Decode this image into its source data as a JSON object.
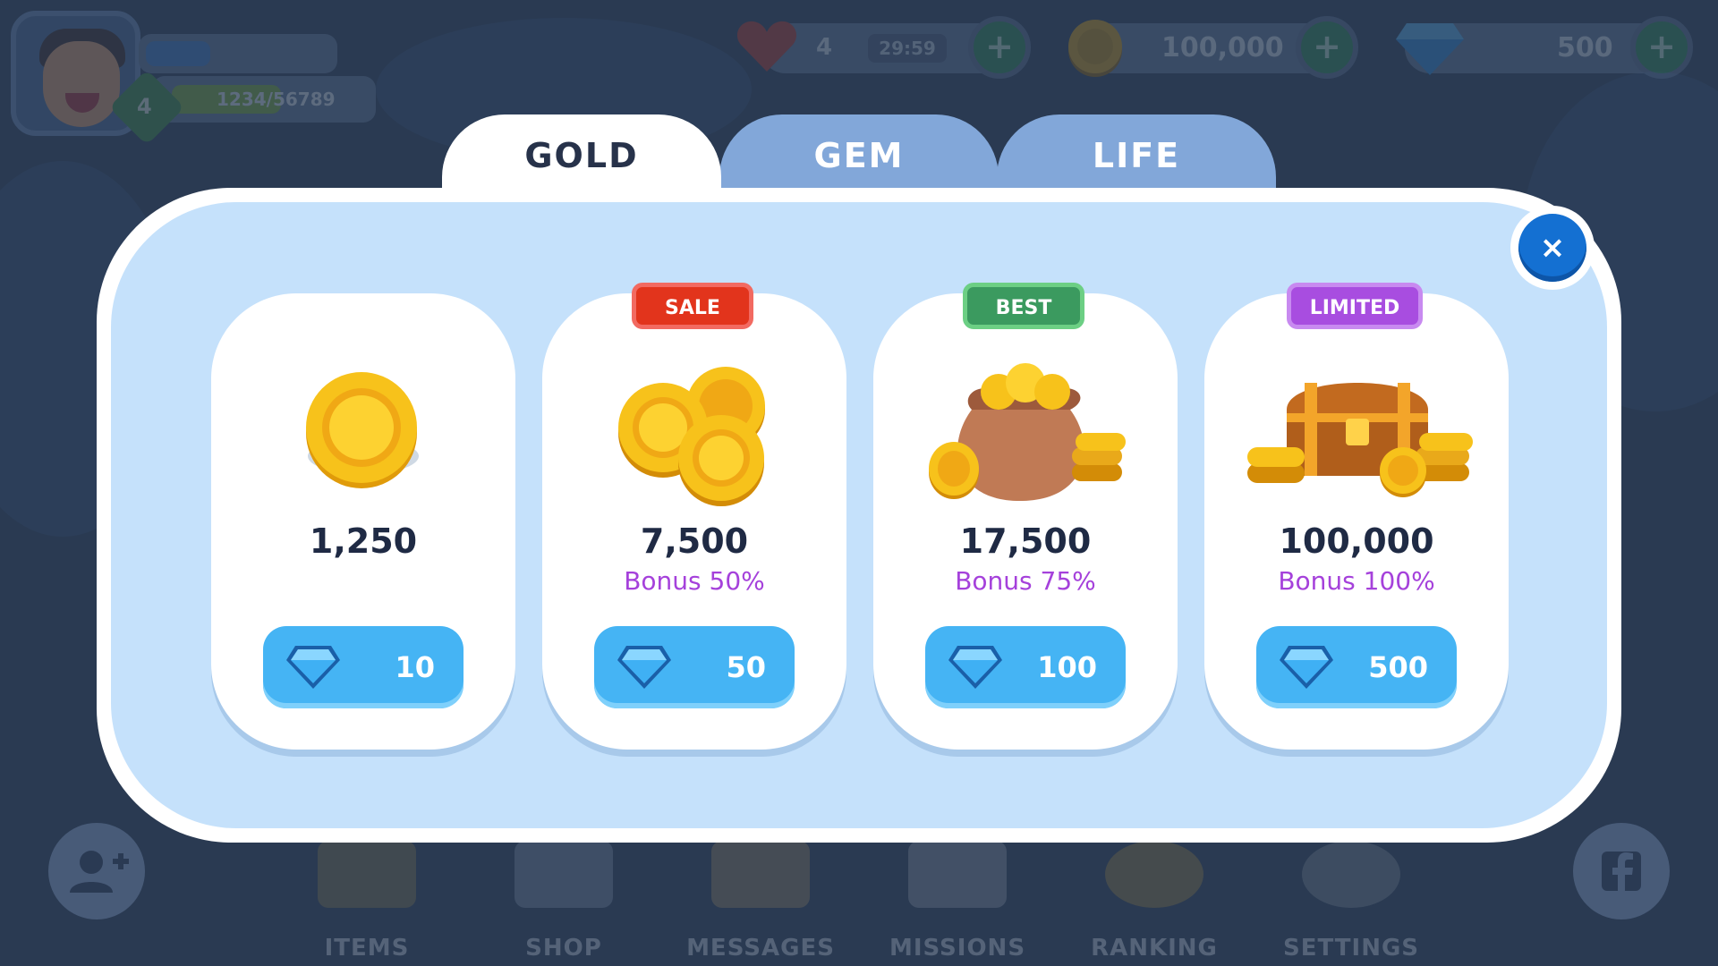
{
  "hud": {
    "level": "4",
    "xp_text": "1234/56789",
    "lives": "4",
    "life_timer": "29:59",
    "gold": "100,000",
    "gems": "500",
    "plus": "+"
  },
  "tabs": [
    {
      "label": "GOLD",
      "active": true
    },
    {
      "label": "GEM",
      "active": false
    },
    {
      "label": "LIFE",
      "active": false
    }
  ],
  "close_label": "×",
  "packs": [
    {
      "tag": "",
      "amount": "1,250",
      "bonus": "",
      "price": "10",
      "art": "single-coin"
    },
    {
      "tag": "SALE",
      "amount": "7,500",
      "bonus": "Bonus 50%",
      "price": "50",
      "art": "coin-stack"
    },
    {
      "tag": "BEST",
      "amount": "17,500",
      "bonus": "Bonus 75%",
      "price": "100",
      "art": "coin-sack"
    },
    {
      "tag": "LIMITED",
      "amount": "100,000",
      "bonus": "Bonus 100%",
      "price": "500",
      "art": "treasure-chest"
    }
  ],
  "nav": {
    "items": [
      "ITEMS",
      "SHOP",
      "MESSAGES",
      "MISSIONS",
      "RANKING",
      "SETTINGS"
    ]
  },
  "colors": {
    "gold": "#f7c21b",
    "gem": "#45b4f4",
    "bonus": "#a541db",
    "sale": "#e2341c",
    "best": "#3b9a5f",
    "limited": "#a84de0"
  }
}
